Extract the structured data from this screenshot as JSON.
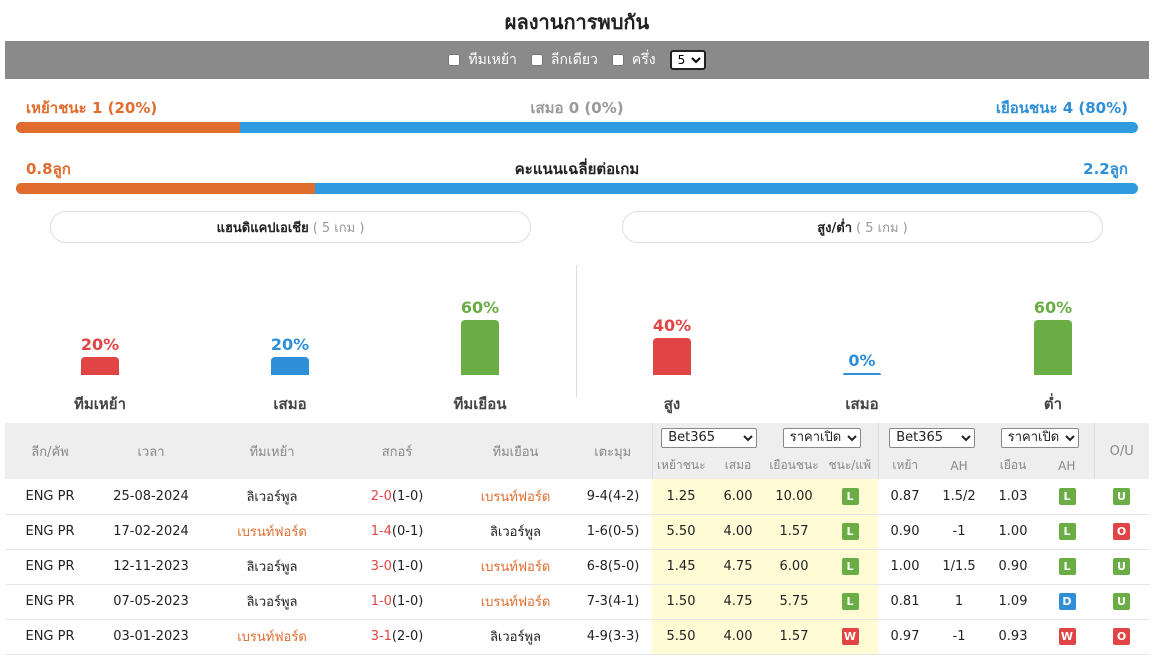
{
  "title": "ผลงานการพบกัน",
  "filters": {
    "home_team_label": "ทีมเหย้า",
    "same_league_label": "ลีกเดียว",
    "half_label": "ครึ่ง",
    "count_value": "5"
  },
  "results": {
    "home_win": "เหย้าชนะ 1 (20%)",
    "draw": "เสมอ 0 (0%)",
    "away_win": "เยือนชนะ 4 (80%)",
    "home_win_share": 0.2
  },
  "goals": {
    "home_avg": "0.8ลูก",
    "label": "คะแนนเฉลี่ยต่อเกม",
    "away_avg": "2.2ลูก",
    "home_share": 0.2667
  },
  "handicap": {
    "title": "แฮนดิแคปเอเชีย",
    "games": "( 5 เกม )",
    "items": [
      {
        "pct": "20%",
        "label": "ทีมเหย้า",
        "value": 20,
        "color": "#e04444"
      },
      {
        "pct": "20%",
        "label": "เสมอ",
        "value": 20,
        "color": "#2e8fd8"
      },
      {
        "pct": "60%",
        "label": "ทีมเยือน",
        "value": 60,
        "color": "#6aad45"
      }
    ]
  },
  "overunder": {
    "title": "สูง/ต่ำ",
    "games": "( 5 เกม )",
    "items": [
      {
        "pct": "40%",
        "label": "สูง",
        "value": 40,
        "color": "#e04444"
      },
      {
        "pct": "0%",
        "label": "เสมอ",
        "value": 0,
        "color": "#2e8fd8"
      },
      {
        "pct": "60%",
        "label": "ต่ำ",
        "value": 60,
        "color": "#6aad45"
      }
    ]
  },
  "table": {
    "headers": {
      "league": "ลีก/คัพ",
      "time": "เวลา",
      "home": "ทีมเหย้า",
      "score": "สกอร์",
      "away": "ทีมเยือน",
      "corner": "เตะมุม",
      "ou": "O/U"
    },
    "bookmaker1": "Bet365",
    "oddtype1": "ราคาเปิด",
    "bookmaker2": "Bet365",
    "oddtype2": "ราคาเปิด",
    "sub_headers": [
      "เหย้าชนะ",
      "เสมอ",
      "เยือนชนะ",
      "ชนะ/แพ้",
      "เหย้า",
      "AH",
      "เยือน",
      "AH"
    ],
    "rows": [
      {
        "league": "ENG PR",
        "date": "25-08-2024",
        "home": "ลิเวอร์พูล",
        "home_style": "normal",
        "score": "2-0",
        "ht": "(1-0)",
        "away": "เบรนท์ฟอร์ด",
        "away_style": "orange",
        "corner": "9-4(4-2)",
        "o1": "1.25",
        "o2": "6.00",
        "o3": "10.00",
        "wl": "L",
        "ah1": "0.87",
        "ah": "1.5/2",
        "ah2": "1.03",
        "ahr": "L",
        "ou": "U"
      },
      {
        "league": "ENG PR",
        "date": "17-02-2024",
        "home": "เบรนท์ฟอร์ด",
        "home_style": "orange",
        "score": "1-4",
        "ht": "(0-1)",
        "away": "ลิเวอร์พูล",
        "away_style": "normal",
        "corner": "1-6(0-5)",
        "o1": "5.50",
        "o2": "4.00",
        "o3": "1.57",
        "wl": "L",
        "ah1": "0.90",
        "ah": "-1",
        "ah2": "1.00",
        "ahr": "L",
        "ou": "O"
      },
      {
        "league": "ENG PR",
        "date": "12-11-2023",
        "home": "ลิเวอร์พูล",
        "home_style": "normal",
        "score": "3-0",
        "ht": "(1-0)",
        "away": "เบรนท์ฟอร์ด",
        "away_style": "orange",
        "corner": "6-8(5-0)",
        "o1": "1.45",
        "o2": "4.75",
        "o3": "6.00",
        "wl": "L",
        "ah1": "1.00",
        "ah": "1/1.5",
        "ah2": "0.90",
        "ahr": "L",
        "ou": "U"
      },
      {
        "league": "ENG PR",
        "date": "07-05-2023",
        "home": "ลิเวอร์พูล",
        "home_style": "normal",
        "score": "1-0",
        "ht": "(1-0)",
        "away": "เบรนท์ฟอร์ด",
        "away_style": "orange",
        "corner": "7-3(4-1)",
        "o1": "1.50",
        "o2": "4.75",
        "o3": "5.75",
        "wl": "L",
        "ah1": "0.81",
        "ah": "1",
        "ah2": "1.09",
        "ahr": "D",
        "ou": "U"
      },
      {
        "league": "ENG PR",
        "date": "03-01-2023",
        "home": "เบรนท์ฟอร์ด",
        "home_style": "orange",
        "score": "3-1",
        "ht": "(2-0)",
        "away": "ลิเวอร์พูล",
        "away_style": "normal",
        "corner": "4-9(3-3)",
        "o1": "5.50",
        "o2": "4.00",
        "o3": "1.57",
        "wl": "W",
        "ah1": "0.97",
        "ah": "-1",
        "ah2": "0.93",
        "ahr": "W",
        "ou": "O"
      }
    ]
  }
}
